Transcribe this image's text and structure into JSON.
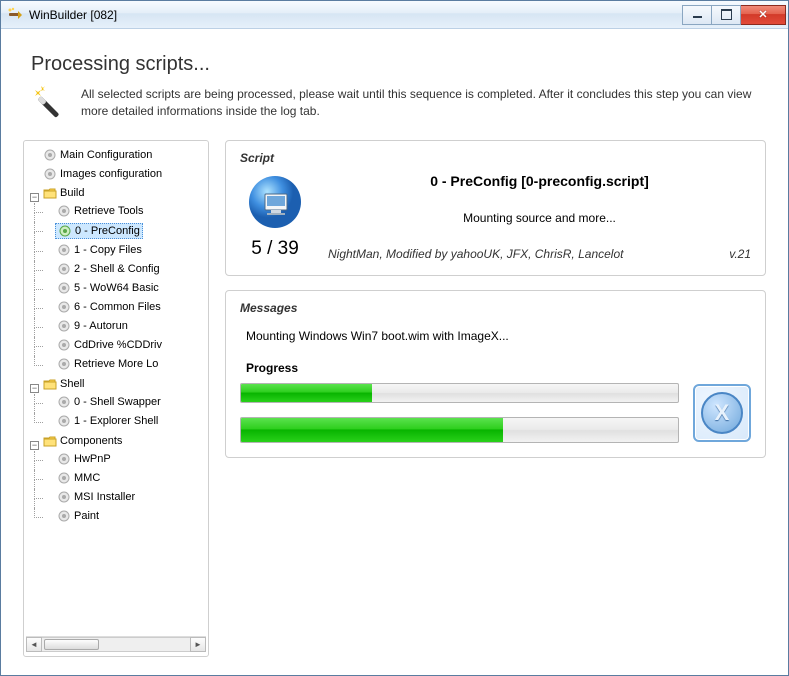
{
  "window": {
    "title": "WinBuilder [082]"
  },
  "header": {
    "title": "Processing scripts...",
    "description": "All selected scripts are being processed, please wait until this sequence is completed. After it concludes this step you can view more detailed informations inside the log tab."
  },
  "tree": {
    "root": [
      {
        "label": "Main Configuration",
        "icon": "gear"
      },
      {
        "label": "Images configuration",
        "icon": "gear"
      },
      {
        "label": "Build",
        "icon": "folder",
        "expanded": true,
        "children": [
          {
            "label": "Retrieve Tools",
            "icon": "gear"
          },
          {
            "label": "0 - PreConfig",
            "icon": "gear-green",
            "selected": true
          },
          {
            "label": "1 - Copy Files",
            "icon": "gear"
          },
          {
            "label": "2 - Shell & Config",
            "icon": "gear"
          },
          {
            "label": "5 - WoW64 Basic",
            "icon": "gear"
          },
          {
            "label": "6 - Common Files",
            "icon": "gear"
          },
          {
            "label": "9 - Autorun",
            "icon": "gear"
          },
          {
            "label": "CdDrive %CDDriv",
            "icon": "gear"
          },
          {
            "label": "Retrieve More Lo",
            "icon": "gear"
          }
        ]
      },
      {
        "label": "Shell",
        "icon": "folder",
        "expanded": true,
        "children": [
          {
            "label": "0 - Shell Swapper",
            "icon": "gear"
          },
          {
            "label": "1 - Explorer Shell",
            "icon": "gear"
          }
        ]
      },
      {
        "label": "Components",
        "icon": "folder",
        "expanded": true,
        "children": [
          {
            "label": "HwPnP",
            "icon": "gear"
          },
          {
            "label": "MMC",
            "icon": "gear"
          },
          {
            "label": "MSI Installer",
            "icon": "gear"
          },
          {
            "label": "Paint",
            "icon": "gear"
          }
        ]
      }
    ]
  },
  "script": {
    "panel_title": "Script",
    "name": "0 - PreConfig [0-preconfig.script]",
    "status": "Mounting source and more...",
    "counter": "5 / 39",
    "authors": "NightMan, Modified by yahooUK, JFX, ChrisR, Lancelot",
    "version": "v.21"
  },
  "messages": {
    "panel_title": "Messages",
    "text": "Mounting Windows Win7 boot.wim with ImageX...",
    "progress_label": "Progress",
    "bar1_percent": 30,
    "bar2_percent": 60
  },
  "cancel_label": "X"
}
